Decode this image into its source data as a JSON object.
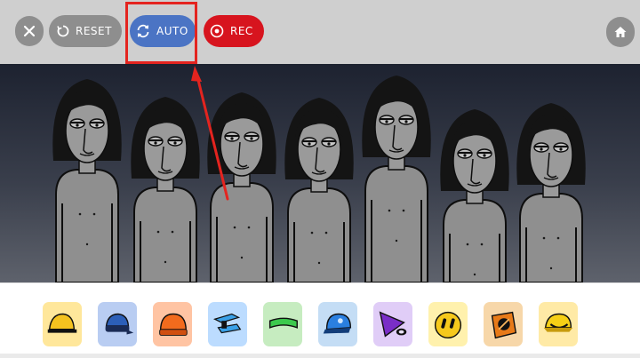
{
  "toolbar": {
    "close_icon": "close-icon",
    "reset_label": "RESET",
    "reset_icon": "restart-icon",
    "auto_label": "AUTO",
    "auto_icon": "refresh-icon",
    "rec_label": "REC",
    "rec_icon": "record-icon",
    "home_icon": "home-icon",
    "auto_color": "#4b74c4",
    "rec_color": "#d7141e",
    "neutral_color": "#8e8e8e"
  },
  "annotation": {
    "color": "#e4241f",
    "target": "auto-button"
  },
  "stage": {
    "character_count": 7,
    "palette": {
      "body": "#8f8f8f",
      "hair": "#141414",
      "skin": "#9a9a9a"
    }
  },
  "sound_tiles": [
    {
      "name": "yellow-hard-hat-icon",
      "bg": "#ffe79b"
    },
    {
      "name": "blue-cap-with-goggles-icon",
      "bg": "#b9cdf2"
    },
    {
      "name": "orange-beanie-icon",
      "bg": "#ffc4a3"
    },
    {
      "name": "blue-shades-icon",
      "bg": "#bcdcff"
    },
    {
      "name": "green-headband-icon",
      "bg": "#c6ecc0"
    },
    {
      "name": "blue-backwards-cap-icon",
      "bg": "#c4ddf5"
    },
    {
      "name": "purple-cone-with-eye-icon",
      "bg": "#e0cdf7"
    },
    {
      "name": "yellow-face-with-eyes-icon",
      "bg": "#fff1ad"
    },
    {
      "name": "orange-mask-icon",
      "bg": "#f7d7a9"
    },
    {
      "name": "yellow-cap-with-smile-icon",
      "bg": "#ffeaa6"
    }
  ]
}
